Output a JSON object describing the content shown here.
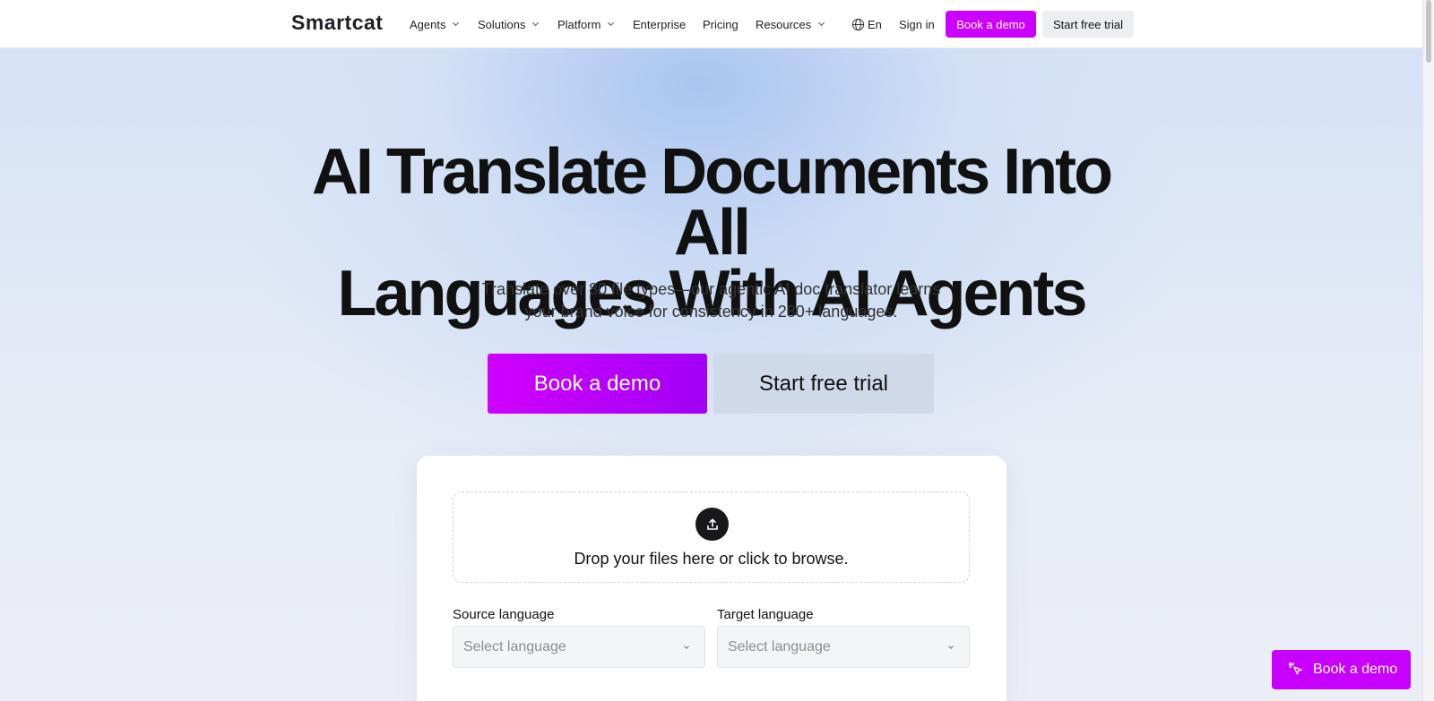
{
  "header": {
    "logo": "Smartcat",
    "nav": [
      {
        "label": "Agents",
        "has_dropdown": true
      },
      {
        "label": "Solutions",
        "has_dropdown": true
      },
      {
        "label": "Platform",
        "has_dropdown": true
      },
      {
        "label": "Enterprise",
        "has_dropdown": false
      },
      {
        "label": "Pricing",
        "has_dropdown": false
      },
      {
        "label": "Resources",
        "has_dropdown": true
      }
    ],
    "language": "En",
    "sign_in": "Sign in",
    "book_demo": "Book a demo",
    "start_trial": "Start free trial"
  },
  "hero": {
    "title_line1": "AI Translate Documents Into All",
    "title_line2": "Languages With AI Agents",
    "subtitle": "Translate over 80 file types—our agentic AI doc translator learns your brand voice for consistency in 280+ languages.",
    "book_demo": "Book a demo",
    "start_trial": "Start free trial"
  },
  "upload": {
    "drop_text": "Drop your files here or click to browse.",
    "source_label": "Source language",
    "source_placeholder": "Select language",
    "target_label": "Target language",
    "target_placeholder": "Select language"
  },
  "floating_cta": {
    "label": "Book a demo"
  },
  "icons": {
    "globe": "globe-icon",
    "upload": "upload-icon",
    "cursor": "cursor-click-icon",
    "chevron": "chevron-down-icon"
  },
  "colors": {
    "accent": "#cc00ff",
    "accent_gradient_end": "#a100f6",
    "secondary_button": "#cfd9e8"
  }
}
